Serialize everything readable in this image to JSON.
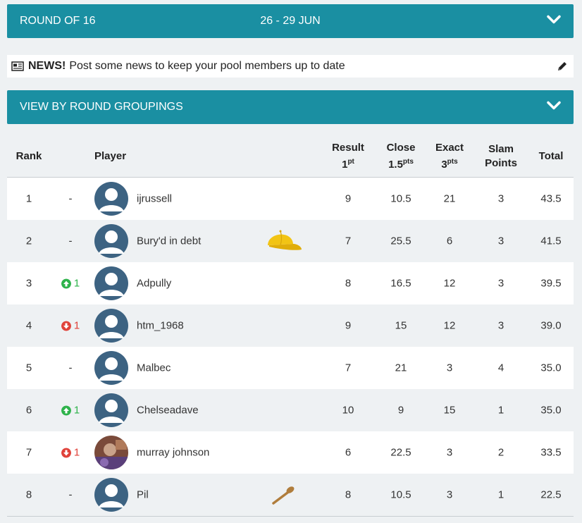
{
  "round_bar": {
    "title": "ROUND OF 16",
    "dates": "26 - 29 JUN"
  },
  "news": {
    "label": "NEWS!",
    "text": "Post some news to keep your pool members up to date"
  },
  "groupings_bar": {
    "title": "VIEW BY ROUND GROUPINGS"
  },
  "table": {
    "headers": {
      "rank": "Rank",
      "player": "Player",
      "result": "Result",
      "result_sub": "1",
      "result_sup": "pt",
      "close": "Close",
      "close_sub": "1.5",
      "close_sup": "pts",
      "exact": "Exact",
      "exact_sub": "3",
      "exact_sup": "pts",
      "slam1": "Slam",
      "slam2": "Points",
      "total": "Total"
    },
    "rows": [
      {
        "rank": "1",
        "move": "-",
        "move_dir": "none",
        "name": "ijrussell",
        "avatar": "default",
        "badge": "",
        "result": "9",
        "close": "10.5",
        "exact": "21",
        "slam": "3",
        "total": "43.5"
      },
      {
        "rank": "2",
        "move": "-",
        "move_dir": "none",
        "name": "Bury'd in debt",
        "avatar": "default",
        "badge": "yellow-cap",
        "result": "7",
        "close": "25.5",
        "exact": "6",
        "slam": "3",
        "total": "41.5"
      },
      {
        "rank": "3",
        "move": "1",
        "move_dir": "up",
        "name": "Adpully",
        "avatar": "default",
        "badge": "",
        "result": "8",
        "close": "16.5",
        "exact": "12",
        "slam": "3",
        "total": "39.5"
      },
      {
        "rank": "4",
        "move": "1",
        "move_dir": "down",
        "name": "htm_1968",
        "avatar": "default",
        "badge": "",
        "result": "9",
        "close": "15",
        "exact": "12",
        "slam": "3",
        "total": "39.0"
      },
      {
        "rank": "5",
        "move": "-",
        "move_dir": "none",
        "name": "Malbec",
        "avatar": "default",
        "badge": "",
        "result": "7",
        "close": "21",
        "exact": "3",
        "slam": "4",
        "total": "35.0"
      },
      {
        "rank": "6",
        "move": "1",
        "move_dir": "up",
        "name": "Chelseadave",
        "avatar": "default",
        "badge": "",
        "result": "10",
        "close": "9",
        "exact": "15",
        "slam": "1",
        "total": "35.0"
      },
      {
        "rank": "7",
        "move": "1",
        "move_dir": "down",
        "name": "murray johnson",
        "avatar": "photo",
        "badge": "",
        "result": "6",
        "close": "22.5",
        "exact": "3",
        "slam": "2",
        "total": "33.5"
      },
      {
        "rank": "8",
        "move": "-",
        "move_dir": "none",
        "name": "Pil",
        "avatar": "default",
        "badge": "wooden-spoon",
        "result": "8",
        "close": "10.5",
        "exact": "3",
        "slam": "1",
        "total": "22.5"
      }
    ]
  },
  "colors": {
    "teal": "#1a8fa2",
    "up": "#2eb34b",
    "down": "#e0423a",
    "avatar_bg": "#3d6382"
  }
}
